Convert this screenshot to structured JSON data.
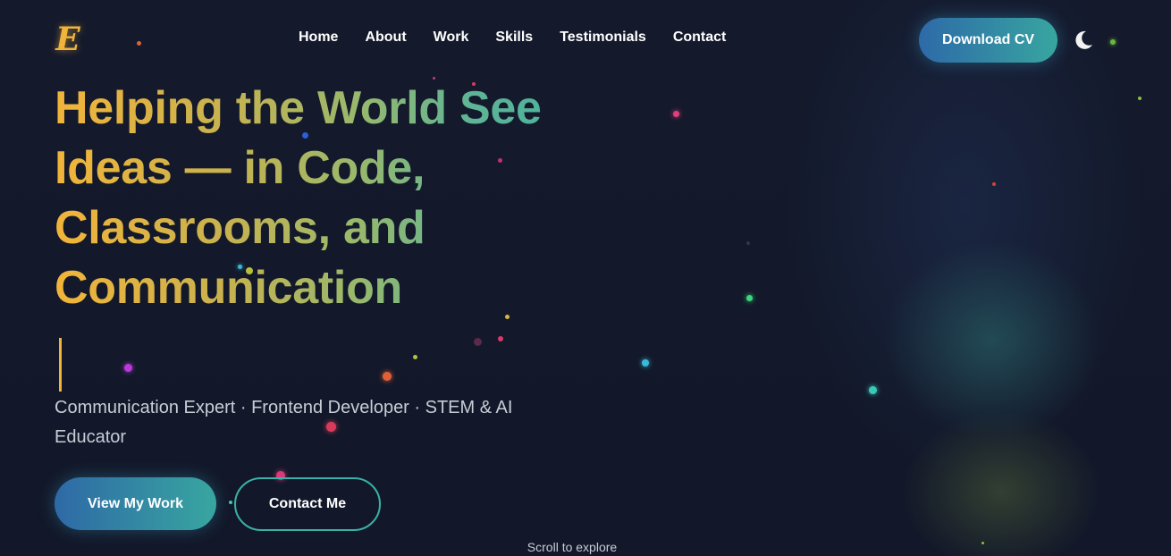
{
  "header": {
    "logo_text": "E",
    "nav": [
      "Home",
      "About",
      "Work",
      "Skills",
      "Testimonials",
      "Contact"
    ],
    "download_label": "Download CV",
    "theme_icon": "moon-icon"
  },
  "hero": {
    "title": "Helping the World See Ideas — in Code, Classrooms, and Communication",
    "subtitle": "Communication Expert · Frontend Developer · STEM & AI Educator",
    "primary_button": "View My Work",
    "secondary_button": "Contact Me",
    "scroll_hint": "Scroll to explore"
  },
  "colors": {
    "background": "#131a2e",
    "accent_gold": "#f1b43b",
    "accent_teal": "#38b2a8",
    "accent_blue": "#2d6aa8"
  }
}
